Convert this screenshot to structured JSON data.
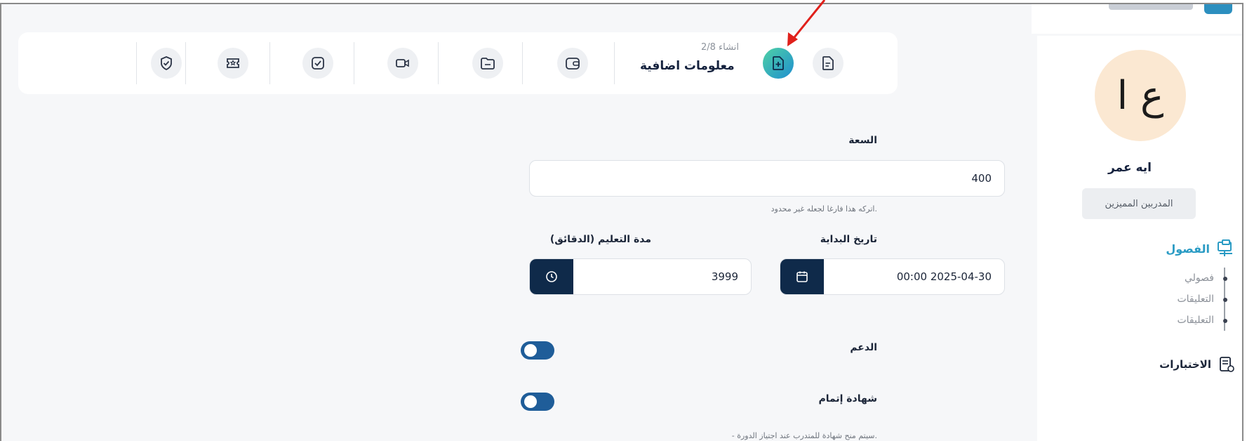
{
  "sidebar": {
    "avatar_initials": "ع ا",
    "user_name": "ايه عمر",
    "role_badge": "المدربين المميزين",
    "section_title": "الفصول",
    "sub_items": [
      "فصولي",
      "التعليقات",
      "التعليقات"
    ],
    "tests_label": "الاختبارات"
  },
  "stepper": {
    "step_count": "انشاء 2/8",
    "current_step_title": "معلومات اضافية",
    "step_icons": [
      "document-icon",
      "document-plus-icon",
      "wallet-icon",
      "folder-icon",
      "video-icon",
      "checkbox-icon",
      "ticket-icon",
      "shield-check-icon"
    ]
  },
  "form": {
    "capacity_label": "السعة",
    "capacity_value": "400",
    "capacity_hint": "اتركه هذا فارغا لجعله غير محدود.",
    "start_date_label": "تاريخ البداية",
    "start_date_value": "00:00 2025-04-30",
    "duration_label": "مدة التعليم (الدقائق)",
    "duration_value": "3999",
    "support_label": "الدعم",
    "support_on": true,
    "certificate_label": "شهادة إتمام",
    "certificate_on": true,
    "certificate_note": "- سيتم منح شهادة للمتدرب عند اجتياز الدورة."
  },
  "colors": {
    "accent": "#2a9bc4",
    "navy": "#0f2a4a",
    "toggle": "#1f5d99",
    "arrow": "#e0201b"
  }
}
